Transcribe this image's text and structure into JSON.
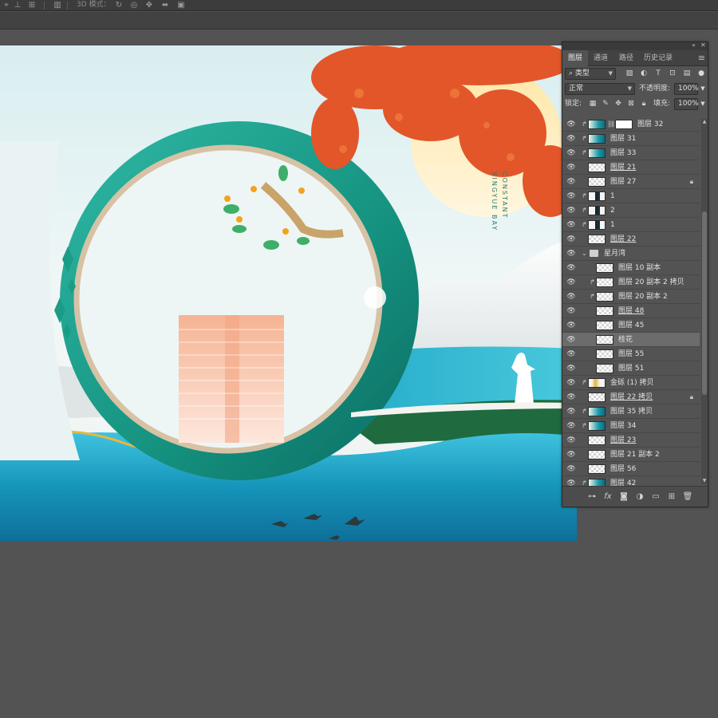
{
  "options_bar": {
    "mode_3d_label": "3D 模式："
  },
  "canvas": {
    "vertical_text_1": "CONSTANT",
    "vertical_text_2": "XINGYUE BAY"
  },
  "panel": {
    "tabs": [
      "图层",
      "通道",
      "路径",
      "历史记录"
    ],
    "active_tab": "图层",
    "filter": {
      "label": "类型",
      "icons": [
        "image-filter-icon",
        "adjustment-filter-icon",
        "type-filter-icon",
        "shape-filter-icon",
        "smart-object-filter-icon"
      ]
    },
    "blend_mode": "正常",
    "opacity_label": "不透明度:",
    "opacity_value": "100%",
    "lock_label": "锁定:",
    "fill_label": "填充:",
    "fill_value": "100%",
    "layers": [
      {
        "name": "图层 32",
        "clip": true,
        "thumb": "teal",
        "mask": true,
        "link": true,
        "underline": false
      },
      {
        "name": "图层 31",
        "clip": true,
        "thumb": "teal",
        "underline": false
      },
      {
        "name": "图层 33",
        "clip": true,
        "thumb": "teal",
        "underline": false
      },
      {
        "name": "图层 21",
        "clip": false,
        "thumb": "checker",
        "underline": true
      },
      {
        "name": "图层 27",
        "clip": false,
        "thumb": "checker",
        "locked": true,
        "underline": false
      },
      {
        "name": "1",
        "clip": true,
        "thumb": "dark",
        "underline": false
      },
      {
        "name": "2",
        "clip": true,
        "thumb": "dark",
        "underline": false
      },
      {
        "name": "1",
        "clip": true,
        "thumb": "dark",
        "underline": false
      },
      {
        "name": "图层 22",
        "clip": false,
        "thumb": "checker",
        "underline": true
      },
      {
        "name": "星月湾",
        "group": true
      },
      {
        "name": "图层 10 副本",
        "clip": false,
        "thumb": "checker",
        "indent": 1
      },
      {
        "name": "图层 20 副本 2 拷贝",
        "clip": true,
        "thumb": "checker",
        "indent": 1
      },
      {
        "name": "图层 20 副本 2",
        "clip": true,
        "thumb": "checker",
        "indent": 1
      },
      {
        "name": "图层 48",
        "clip": false,
        "thumb": "checker",
        "indent": 1,
        "underline": true
      },
      {
        "name": "图层 45",
        "clip": false,
        "thumb": "checker",
        "indent": 1
      },
      {
        "name": "桂花",
        "clip": false,
        "thumb": "checker",
        "indent": 1,
        "selected": true
      },
      {
        "name": "图层 55",
        "clip": false,
        "thumb": "checker",
        "indent": 1
      },
      {
        "name": "图层 51",
        "clip": false,
        "thumb": "checker",
        "indent": 1
      },
      {
        "name": "金砾 (1) 拷贝",
        "clip": true,
        "thumb": "gold",
        "indent": 0
      },
      {
        "name": "图层 22 拷贝",
        "clip": false,
        "thumb": "checker",
        "locked": true,
        "underline": true
      },
      {
        "name": "图层 35 拷贝",
        "clip": true,
        "thumb": "teal"
      },
      {
        "name": "图层 34",
        "clip": true,
        "thumb": "teal"
      },
      {
        "name": "图层 23",
        "clip": false,
        "thumb": "checker",
        "underline": true
      },
      {
        "name": "图层 21 副本 2",
        "clip": false,
        "thumb": "checker"
      },
      {
        "name": "图层 56",
        "clip": false,
        "thumb": "checker"
      },
      {
        "name": "图层 42",
        "clip": true,
        "thumb": "teal"
      }
    ],
    "footer_icons": [
      "link-icon",
      "fx-icon",
      "mask-icon",
      "adjustment-icon",
      "group-icon",
      "new-layer-icon",
      "delete-icon"
    ],
    "footer_labels": {
      "fx": "fx"
    }
  },
  "colors": {
    "app_bg": "#535353",
    "panel_bg": "#535353",
    "teal": "#1aa89a",
    "orange": "#e2562a",
    "sea": "#1497b8"
  }
}
